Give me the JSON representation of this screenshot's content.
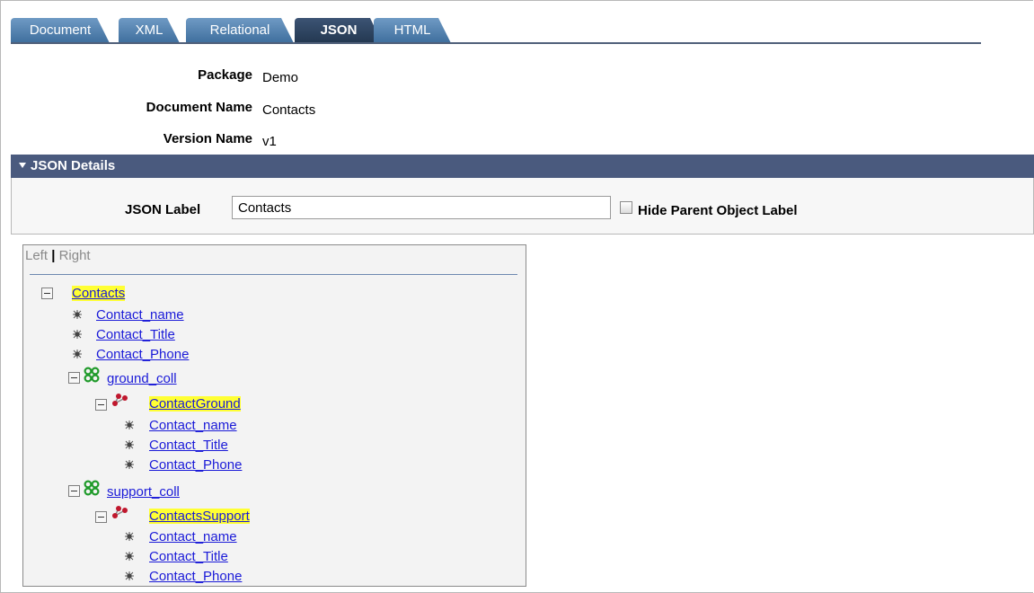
{
  "tabs": [
    {
      "label": "Document",
      "active": false
    },
    {
      "label": "XML",
      "active": false
    },
    {
      "label": "Relational",
      "active": false
    },
    {
      "label": "JSON",
      "active": true
    },
    {
      "label": "HTML",
      "active": false
    }
  ],
  "header": {
    "package_label": "Package",
    "package_value": "Demo",
    "document_name_label": "Document Name",
    "document_name_value": "Contacts",
    "version_name_label": "Version Name",
    "version_name_value": "v1"
  },
  "json_details": {
    "title": "JSON Details",
    "json_label_label": "JSON Label",
    "json_label_value": "Contacts",
    "hide_parent_label": "Hide Parent Object Label",
    "hide_parent_checked": false
  },
  "tree": {
    "left_link": "Left",
    "separator": "|",
    "right_link": "Right",
    "root": "Contacts",
    "root_fields": [
      "Contact_name",
      "Contact_Title",
      "Contact_Phone"
    ],
    "collections": [
      {
        "name": "ground_coll",
        "object": "ContactGround",
        "fields": [
          "Contact_name",
          "Contact_Title",
          "Contact_Phone"
        ]
      },
      {
        "name": "support_coll",
        "object": "ContactsSupport",
        "fields": [
          "Contact_name",
          "Contact_Title",
          "Contact_Phone"
        ]
      }
    ]
  },
  "colors": {
    "tab_bg": "#4f7fb0",
    "tab_active_bg": "#2c405e",
    "section_bar": "#4a5a7e",
    "link": "#1a1ad8",
    "highlight": "#ffff33"
  }
}
